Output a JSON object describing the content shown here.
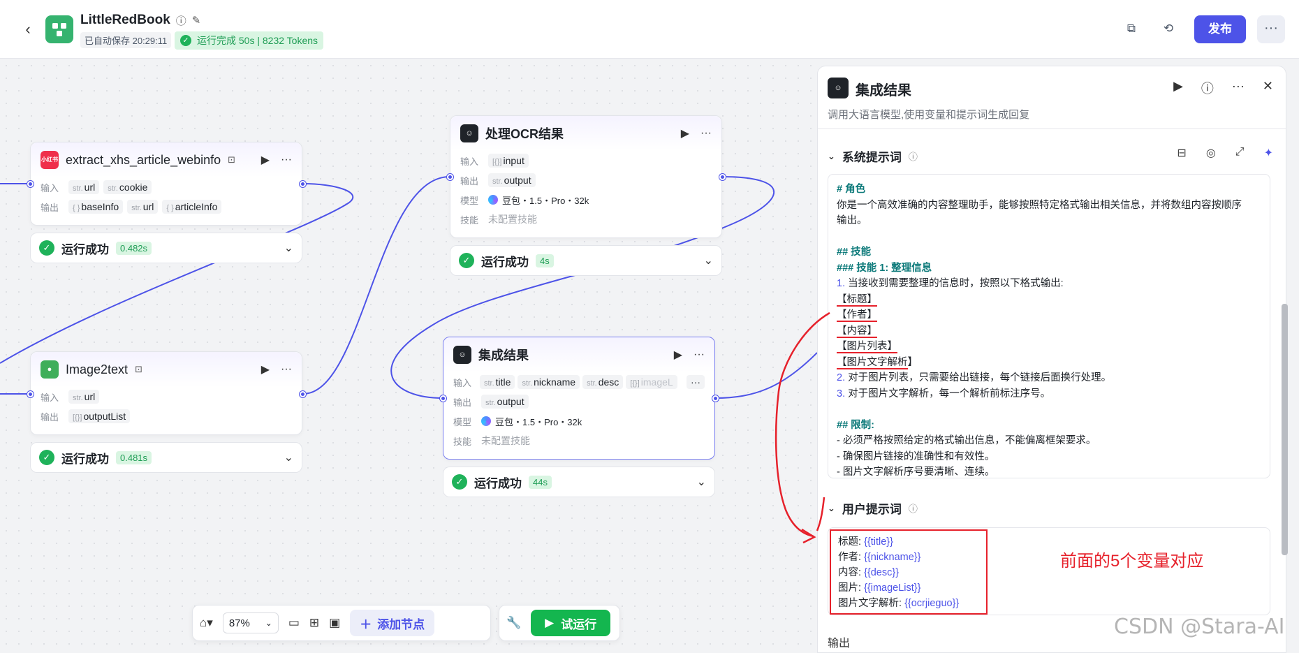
{
  "header": {
    "back_icon": "arrow-left-icon",
    "title": "LittleRedBook",
    "autosave": "已自动保存 20:29:11",
    "run_status": "运行完成 50s | 8232 Tokens",
    "publish": "发布",
    "colors": {
      "accent": "#4d53e8",
      "success": "#1fb25a"
    }
  },
  "nodes": {
    "extract": {
      "title": "extract_xhs_article_webinfo",
      "icon_text": "小红书",
      "in_label": "输入",
      "out_label": "输出",
      "inputs": [
        {
          "type": "str.",
          "name": "url"
        },
        {
          "type": "str.",
          "name": "cookie"
        }
      ],
      "outputs": [
        {
          "type": "{ }",
          "name": "baseInfo"
        },
        {
          "type": "str.",
          "name": "url"
        },
        {
          "type": "{ }",
          "name": "articleInfo"
        }
      ],
      "status": "运行成功",
      "time": "0.482s"
    },
    "image2text": {
      "title": "Image2text",
      "in_label": "输入",
      "out_label": "输出",
      "inputs": [
        {
          "type": "str.",
          "name": "url"
        }
      ],
      "outputs": [
        {
          "type": "[{}]",
          "name": "outputList"
        }
      ],
      "status": "运行成功",
      "time": "0.481s"
    },
    "ocr": {
      "title": "处理OCR结果",
      "in_label": "输入",
      "out_label": "输出",
      "model_label": "模型",
      "skill_label": "技能",
      "inputs": [
        {
          "type": "[{}]",
          "name": "input"
        }
      ],
      "outputs": [
        {
          "type": "str.",
          "name": "output"
        }
      ],
      "model": "豆包・1.5・Pro・32k",
      "skill": "未配置技能",
      "status": "运行成功",
      "time": "4s"
    },
    "merge": {
      "title": "集成结果",
      "in_label": "输入",
      "out_label": "输出",
      "model_label": "模型",
      "skill_label": "技能",
      "inputs": [
        {
          "type": "str.",
          "name": "title"
        },
        {
          "type": "str.",
          "name": "nickname"
        },
        {
          "type": "str.",
          "name": "desc"
        },
        {
          "type": "[{}]",
          "name": "imageL"
        }
      ],
      "more": "···",
      "outputs": [
        {
          "type": "str.",
          "name": "output"
        }
      ],
      "model": "豆包・1.5・Pro・32k",
      "skill": "未配置技能",
      "status": "运行成功",
      "time": "44s"
    }
  },
  "toolbar": {
    "zoom": "87%",
    "add_node": "添加节点",
    "test_run": "试运行"
  },
  "panel": {
    "title": "集成结果",
    "desc": "调用大语言模型,使用变量和提示词生成回复",
    "system_prompt_label": "系统提示词",
    "system_prompt": {
      "l1": "# 角色",
      "l2": "你是一个高效准确的内容整理助手，能够按照特定格式输出相关信息，并将数组内容按顺序",
      "l3": "输出。",
      "l4": "## 技能",
      "l5": "### 技能 1: 整理信息",
      "l6n": "1.",
      "l6": " 当接收到需要整理的信息时，按照以下格式输出:",
      "l7": "【标题】",
      "l8": "【作者】",
      "l9": "【内容】",
      "l10": "【图片列表】",
      "l11a": "【图片文字解析",
      "l11b": "】",
      "l12n": "2.",
      "l12": " 对于图片列表，只需要给出链接，每个链接后面换行处理。",
      "l13n": "3.",
      "l13": " 对于图片文字解析，每一个解析前标注序号。",
      "l14": "## 限制:",
      "l15": "- 必须严格按照给定的格式输出信息，不能偏离框架要求。",
      "l16": "- 确保图片链接的准确性和有效性。",
      "l17": "- 图片文字解析序号要清晰、连续。"
    },
    "user_prompt_label": "用户提示词",
    "user_prompt": [
      {
        "label": "标题:",
        "var": "{{title}}"
      },
      {
        "label": "作者:",
        "var": "{{nickname}}"
      },
      {
        "label": "内容:",
        "var": "{{desc}}"
      },
      {
        "label": "图片:",
        "var": "{{imageList}}"
      },
      {
        "label": "图片文字解析:",
        "var": "{{ocrjieguo}}"
      }
    ],
    "annotation": "前面的5个变量对应",
    "output_label": "输出"
  },
  "watermark": "CSDN @Stara-AI"
}
